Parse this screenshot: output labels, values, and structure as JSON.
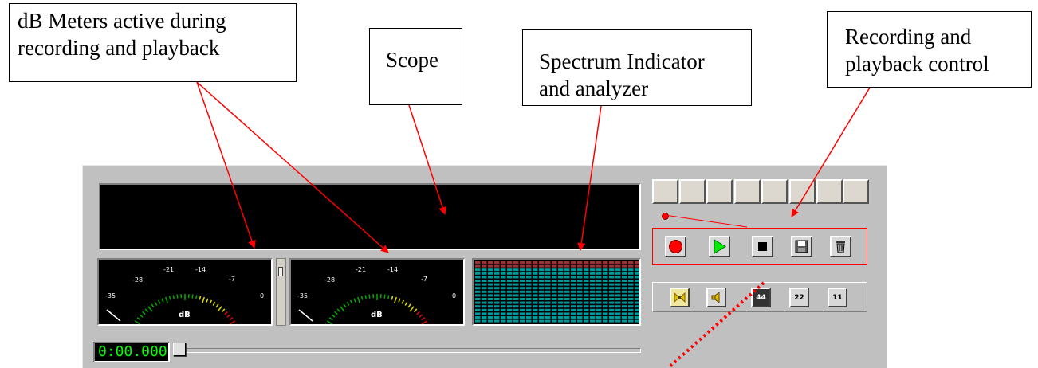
{
  "callouts": {
    "meters": [
      "dB Meters active during",
      "recording and playback"
    ],
    "scope": "Scope",
    "spectrum": [
      "Spectrum Indicator",
      "and analyzer"
    ],
    "control": [
      "Recording and",
      "playback control"
    ]
  },
  "meter": {
    "ticks": [
      "-35",
      "-28",
      "-21",
      "-14",
      "-7",
      "0"
    ],
    "unit": "dB"
  },
  "time_display": "0:00.000",
  "sample_rates": [
    "44",
    "22",
    "11"
  ],
  "colors": {
    "arrow": "#ff0000",
    "time": "#00ff00",
    "spectrum": "#009999",
    "spectrum_top": "#993333"
  },
  "icons": [
    "record-icon",
    "play-icon",
    "stop-icon",
    "save-icon",
    "trash-icon",
    "loop-icon",
    "speaker-icon"
  ]
}
